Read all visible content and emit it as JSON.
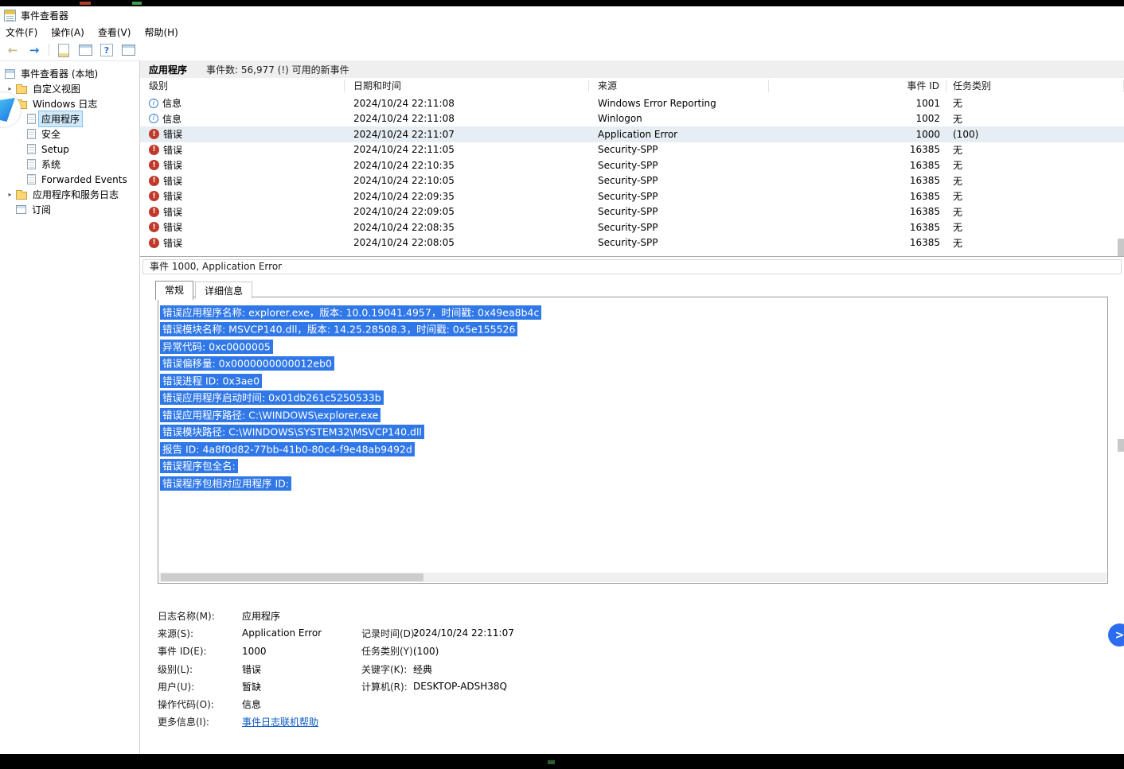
{
  "colors": {
    "selection_blue": "#3078e8",
    "error_red": "#c0392b",
    "info_blue": "#3a7bd5",
    "link_blue": "#0a58c6"
  },
  "window": {
    "title": "事件查看器",
    "menu": [
      "文件(F)",
      "操作(A)",
      "查看(V)",
      "帮助(H)"
    ]
  },
  "sidebar": {
    "items": [
      {
        "label": "事件查看器 (本地)"
      },
      {
        "label": "自定义视图"
      },
      {
        "label": "Windows 日志"
      },
      {
        "label": "应用程序"
      },
      {
        "label": "安全"
      },
      {
        "label": "Setup"
      },
      {
        "label": "系统"
      },
      {
        "label": "Forwarded Events"
      },
      {
        "label": "应用程序和服务日志"
      },
      {
        "label": "订阅"
      }
    ]
  },
  "content_header": {
    "title": "应用程序",
    "summary": "事件数: 56,977 (!) 可用的新事件"
  },
  "table": {
    "columns": [
      "级别",
      "日期和时间",
      "来源",
      "事件 ID",
      "任务类别"
    ],
    "rows": [
      {
        "level": "信息",
        "datetime": "2024/10/24 22:11:08",
        "source": "Windows Error Reporting",
        "event_id": "1001",
        "category": "无"
      },
      {
        "level": "信息",
        "datetime": "2024/10/24 22:11:08",
        "source": "Winlogon",
        "event_id": "1002",
        "category": "无"
      },
      {
        "level": "错误",
        "datetime": "2024/10/24 22:11:07",
        "source": "Application Error",
        "event_id": "1000",
        "category": "(100)"
      },
      {
        "level": "错误",
        "datetime": "2024/10/24 22:11:05",
        "source": "Security-SPP",
        "event_id": "16385",
        "category": "无"
      },
      {
        "level": "错误",
        "datetime": "2024/10/24 22:10:35",
        "source": "Security-SPP",
        "event_id": "16385",
        "category": "无"
      },
      {
        "level": "错误",
        "datetime": "2024/10/24 22:10:05",
        "source": "Security-SPP",
        "event_id": "16385",
        "category": "无"
      },
      {
        "level": "错误",
        "datetime": "2024/10/24 22:09:35",
        "source": "Security-SPP",
        "event_id": "16385",
        "category": "无"
      },
      {
        "level": "错误",
        "datetime": "2024/10/24 22:09:05",
        "source": "Security-SPP",
        "event_id": "16385",
        "category": "无"
      },
      {
        "level": "错误",
        "datetime": "2024/10/24 22:08:35",
        "source": "Security-SPP",
        "event_id": "16385",
        "category": "无"
      },
      {
        "level": "错误",
        "datetime": "2024/10/24 22:08:05",
        "source": "Security-SPP",
        "event_id": "16385",
        "category": "无"
      }
    ]
  },
  "preview": {
    "title": "事件 1000, Application Error",
    "tabs": [
      "常规",
      "详细信息"
    ],
    "lines": [
      "错误应用程序名称: explorer.exe，版本: 10.0.19041.4957，时间戳: 0x49ea8b4c",
      "错误模块名称: MSVCP140.dll，版本: 14.25.28508.3，时间戳: 0x5e155526",
      "异常代码: 0xc0000005",
      "错误偏移量: 0x0000000000012eb0",
      "错误进程 ID: 0x3ae0",
      "错误应用程序启动时间: 0x01db261c5250533b",
      "错误应用程序路径: C:\\WINDOWS\\explorer.exe",
      "错误模块路径: C:\\WINDOWS\\SYSTEM32\\MSVCP140.dll",
      "报告 ID: 4a8f0d82-77bb-41b0-80c4-f9e48ab9492d",
      "错误程序包全名:",
      "错误程序包相对应用程序 ID:"
    ],
    "fields": [
      {
        "l1": "日志名称(M):",
        "v1": "应用程序",
        "l2": "",
        "v2": ""
      },
      {
        "l1": "来源(S):",
        "v1": "Application Error",
        "l2": "记录时间(D):",
        "v2": "2024/10/24 22:11:07"
      },
      {
        "l1": "事件 ID(E):",
        "v1": "1000",
        "l2": "任务类别(Y):",
        "v2": "(100)"
      },
      {
        "l1": "级别(L):",
        "v1": "错误",
        "l2": "关键字(K):",
        "v2": "经典"
      },
      {
        "l1": "用户(U):",
        "v1": "暂缺",
        "l2": "计算机(R):",
        "v2": "DESKTOP-ADSH38Q"
      },
      {
        "l1": "操作代码(O):",
        "v1": "信息",
        "l2": "",
        "v2": ""
      }
    ],
    "more_info_label": "更多信息(I):",
    "more_info_link": "事件日志联机帮助"
  }
}
